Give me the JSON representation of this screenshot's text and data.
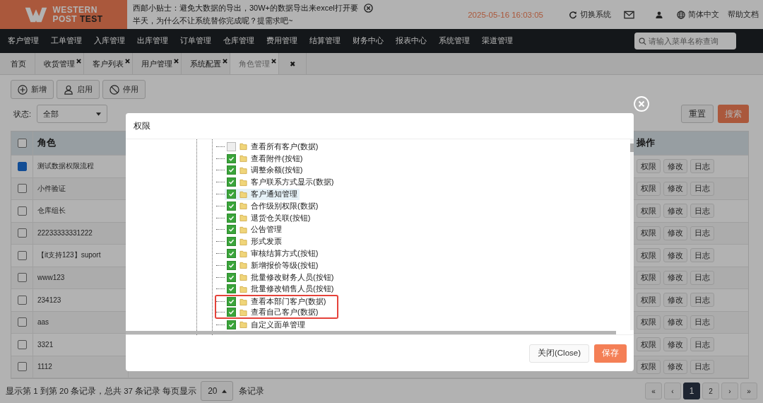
{
  "logo": {
    "name": "WESTERN",
    "sub": "POST",
    "accent": "TEST"
  },
  "tip": {
    "lines": [
      "西邮小贴士：避免大数据的导出，30W+的数据导出来excel打开要",
      "半天，为什么不让系统替你完成呢？提需求吧~"
    ]
  },
  "datetime": "2025-05-16 16:03:05",
  "header_actions": {
    "switch": "切换系统",
    "language": "简体中文",
    "help": "帮助文档"
  },
  "nav": {
    "items": [
      "客户管理",
      "工单管理",
      "入库管理",
      "出库管理",
      "订单管理",
      "仓库管理",
      "费用管理",
      "结算管理",
      "财务中心",
      "报表中心",
      "系统管理",
      "渠道管理"
    ],
    "search": {
      "placeholder": "请输入菜单名称查询"
    }
  },
  "tabs": [
    {
      "label": "首页",
      "closable": false,
      "selected": false
    },
    {
      "label": "收货管理",
      "closable": true,
      "selected": false
    },
    {
      "label": "客户列表",
      "closable": true,
      "selected": false
    },
    {
      "label": "用户管理",
      "closable": true,
      "selected": false
    },
    {
      "label": "系统配置",
      "closable": true,
      "selected": false
    },
    {
      "label": "角色管理",
      "closable": true,
      "selected": true
    }
  ],
  "close_all_tab": "✖",
  "toolbar": [
    {
      "label": "新增",
      "kind": "plus"
    },
    {
      "label": "启用",
      "kind": "user"
    },
    {
      "label": "停用",
      "kind": "ban"
    }
  ],
  "filter": {
    "label": "状态:",
    "select": "全部",
    "reset": "重置",
    "search": "搜索"
  },
  "table": {
    "columns": [
      "角色",
      "操作"
    ],
    "header_checked": false,
    "rows": [
      {
        "role": "测试数据权限流程",
        "checked": true,
        "actions": [
          "权限",
          "修改",
          "日志"
        ]
      },
      {
        "role": "小件验证",
        "checked": false,
        "actions": [
          "权限",
          "修改",
          "日志"
        ]
      },
      {
        "role": "仓库组长",
        "checked": false,
        "actions": [
          "权限",
          "修改",
          "日志"
        ]
      },
      {
        "role": "22233333331222",
        "checked": false,
        "actions": [
          "权限",
          "修改",
          "日志"
        ]
      },
      {
        "role": "【it支持123】suport",
        "checked": false,
        "actions": [
          "权限",
          "修改",
          "日志"
        ]
      },
      {
        "role": "www123",
        "checked": false,
        "actions": [
          "权限",
          "修改",
          "日志"
        ]
      },
      {
        "role": "234123",
        "checked": false,
        "actions": [
          "权限",
          "修改",
          "日志"
        ]
      },
      {
        "role": "aas",
        "checked": false,
        "actions": [
          "权限",
          "修改",
          "日志"
        ]
      },
      {
        "role": "3321",
        "checked": false,
        "actions": [
          "权限",
          "修改",
          "日志"
        ]
      },
      {
        "role": "1112",
        "checked": false,
        "actions": [
          "权限",
          "修改",
          "日志"
        ]
      }
    ]
  },
  "modal": {
    "title": "权限",
    "tree": [
      {
        "label": "查看所有客户(数据)",
        "checked": false,
        "selected": false,
        "boxed": false
      },
      {
        "label": "查看附件(按钮)",
        "checked": true,
        "selected": false,
        "boxed": false
      },
      {
        "label": "调整余额(按钮)",
        "checked": true,
        "selected": false,
        "boxed": false
      },
      {
        "label": "客户联系方式显示(数据)",
        "checked": true,
        "selected": false,
        "boxed": false
      },
      {
        "label": "客户通知管理",
        "checked": true,
        "selected": true,
        "boxed": false
      },
      {
        "label": "合作级别权限(数据)",
        "checked": true,
        "selected": false,
        "boxed": false
      },
      {
        "label": "退货仓关联(按钮)",
        "checked": true,
        "selected": false,
        "boxed": false
      },
      {
        "label": "公告管理",
        "checked": true,
        "selected": false,
        "boxed": false
      },
      {
        "label": "形式发票",
        "checked": true,
        "selected": false,
        "boxed": false
      },
      {
        "label": "审核结算方式(按钮)",
        "checked": true,
        "selected": false,
        "boxed": false
      },
      {
        "label": "新增报价等级(按钮)",
        "checked": true,
        "selected": false,
        "boxed": false
      },
      {
        "label": "批量修改财务人员(按钮)",
        "checked": true,
        "selected": false,
        "boxed": false
      },
      {
        "label": "批量修改销售人员(按钮)",
        "checked": true,
        "selected": false,
        "boxed": false
      },
      {
        "label": "查看本部门客户(数据)",
        "checked": true,
        "selected": false,
        "boxed": true
      },
      {
        "label": "查看自己客户(数据)",
        "checked": true,
        "selected": false,
        "boxed": true
      },
      {
        "label": "自定义面单管理",
        "checked": true,
        "selected": false,
        "boxed": false
      }
    ],
    "buttons": {
      "close": "关闭(Close)",
      "save": "保存"
    }
  },
  "footer": {
    "summary": "显示第 1 到第 20 条记录，总共 37 条记录 每页显示",
    "page_size": "20",
    "page_size_suffix": "条记录",
    "pages": [
      {
        "label": "«",
        "selected": false
      },
      {
        "label": "‹",
        "selected": false
      },
      {
        "label": "1",
        "selected": true
      },
      {
        "label": "2",
        "selected": false
      },
      {
        "label": "›",
        "selected": false
      },
      {
        "label": "»",
        "selected": false
      }
    ]
  }
}
